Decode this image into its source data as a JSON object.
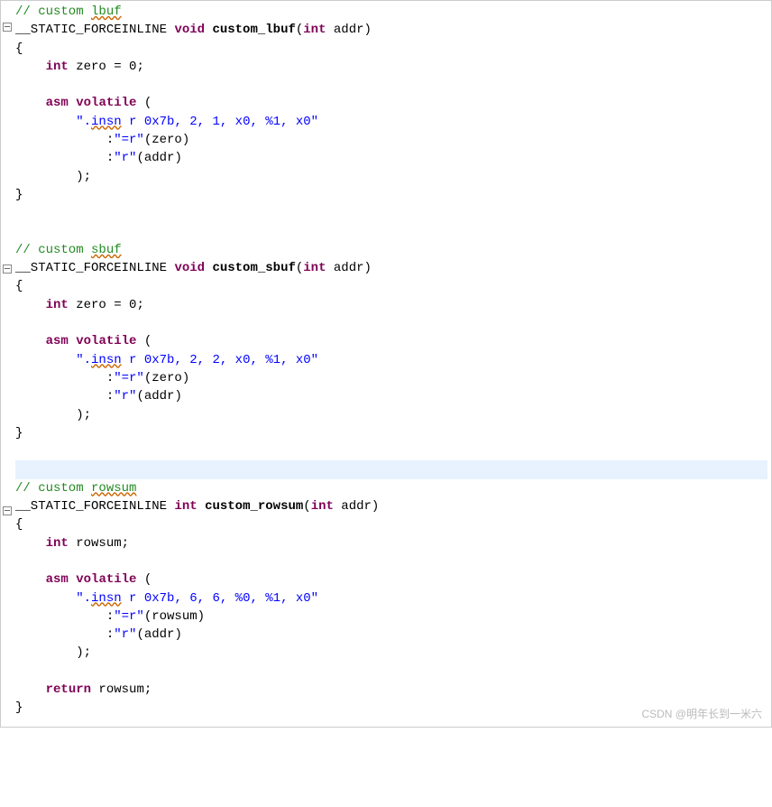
{
  "watermark": "CSDN @明年长到一米六",
  "functions": [
    {
      "comment_prefix": "// custom ",
      "comment_word": "lbuf",
      "sig_pre": "__STATIC_FORCEINLINE ",
      "ret_type": "void",
      "func_name": "custom_lbuf",
      "param_type": "int",
      "param_name": " addr)",
      "decl_kw": "int",
      "decl_rest": " zero = 0;",
      "asm_kw1": "asm",
      "asm_kw2": "volatile",
      "open": " (",
      "insn_pre": "\".",
      "insn_word": "insn",
      "insn_rest": " r 0x7b, 2, 1, x0, %1, x0\"",
      "out_pre": ":",
      "out_str": "\"=r\"",
      "out_var": "(zero)",
      "in_pre": ":",
      "in_str": "\"r\"",
      "in_var": "(addr)",
      "close": ");",
      "has_return": false
    },
    {
      "comment_prefix": "// custom ",
      "comment_word": "sbuf",
      "sig_pre": "__STATIC_FORCEINLINE ",
      "ret_type": "void",
      "func_name": "custom_sbuf",
      "param_type": "int",
      "param_name": " addr)",
      "decl_kw": "int",
      "decl_rest": " zero = 0;",
      "asm_kw1": "asm",
      "asm_kw2": "volatile",
      "open": " (",
      "insn_pre": "\".",
      "insn_word": "insn",
      "insn_rest": " r 0x7b, 2, 2, x0, %1, x0\"",
      "out_pre": ":",
      "out_str": "\"=r\"",
      "out_var": "(zero)",
      "in_pre": ":",
      "in_str": "\"r\"",
      "in_var": "(addr)",
      "close": ");",
      "has_return": false
    },
    {
      "comment_prefix": "// custom ",
      "comment_word": "rowsum",
      "sig_pre": "__STATIC_FORCEINLINE ",
      "ret_type": "int",
      "func_name": "custom_rowsum",
      "param_type": "int",
      "param_name": " addr)",
      "decl_kw": "int",
      "decl_rest": " rowsum;",
      "asm_kw1": "asm",
      "asm_kw2": "volatile",
      "open": " (",
      "insn_pre": "\".",
      "insn_word": "insn",
      "insn_rest": " r 0x7b, 6, 6, %0, %1, x0\"",
      "out_pre": ":",
      "out_str": "\"=r\"",
      "out_var": "(rowsum)",
      "in_pre": ":",
      "in_str": "\"r\"",
      "in_var": "(addr)",
      "close": ");",
      "has_return": true,
      "ret_kw": "return",
      "ret_rest": " rowsum;"
    }
  ]
}
